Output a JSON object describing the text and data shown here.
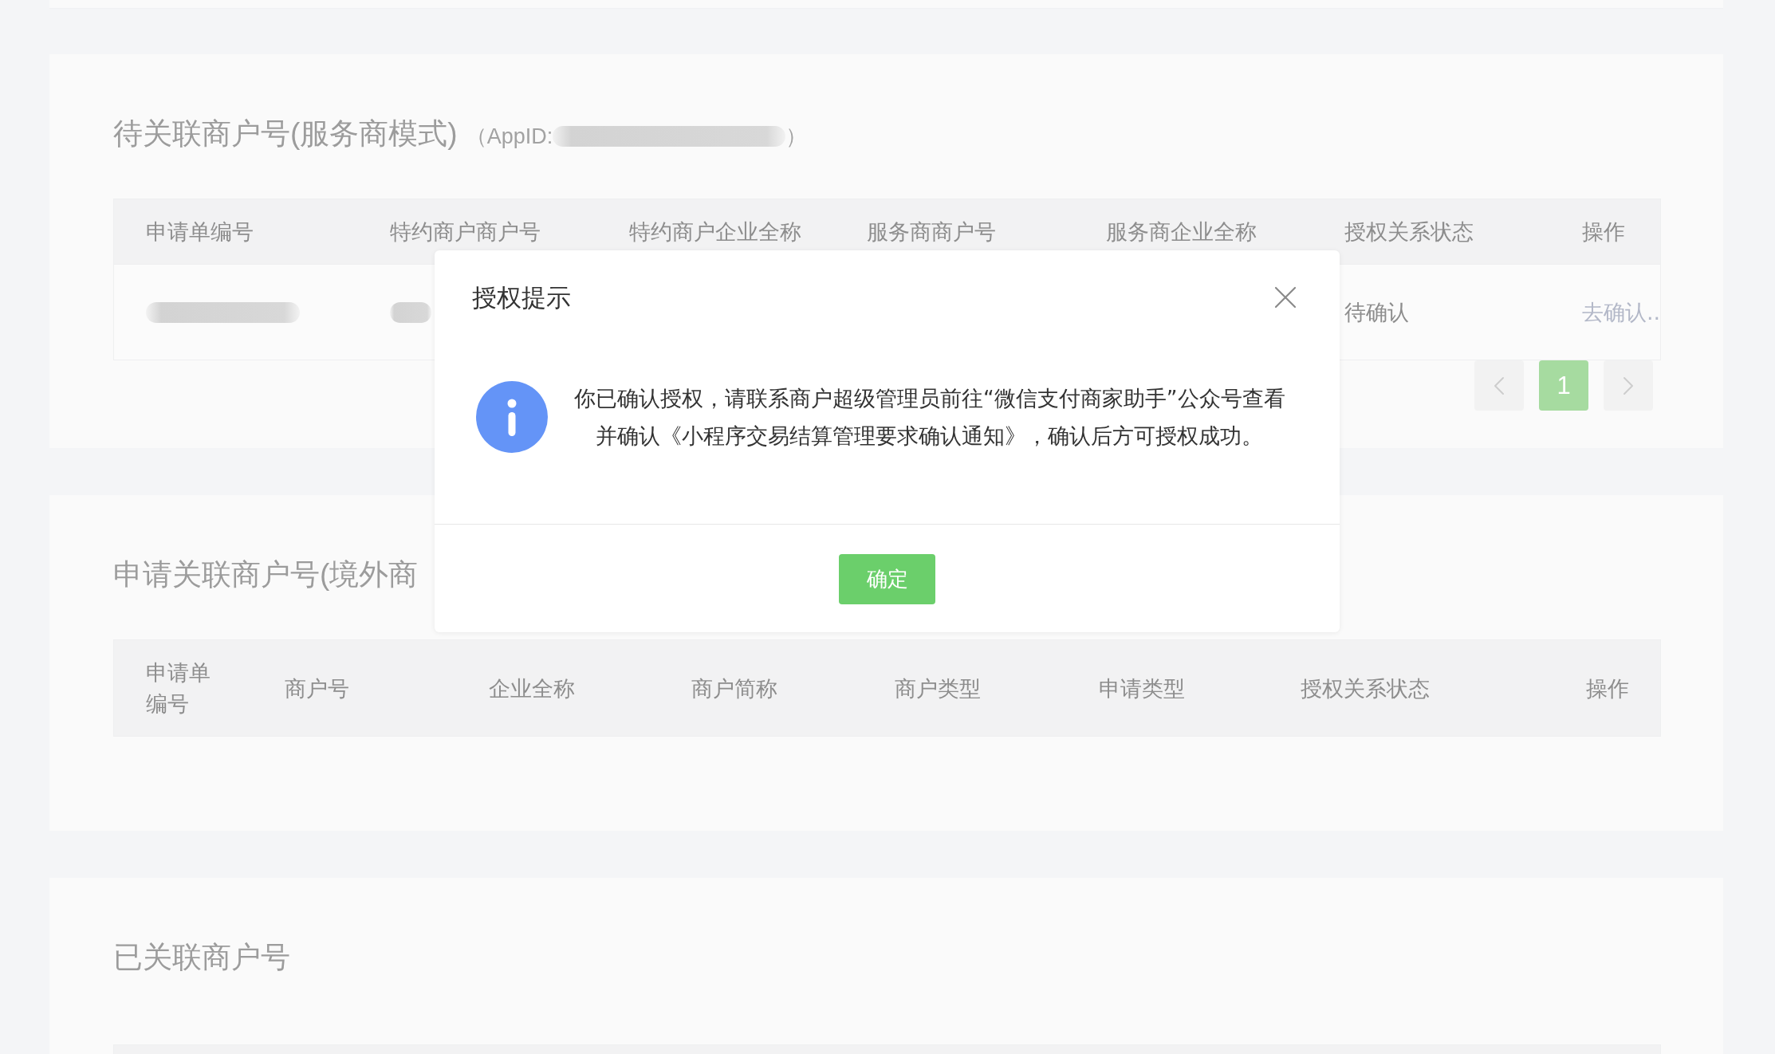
{
  "sections": [
    {
      "title": "待关联商户号(服务商模式)",
      "appid": {
        "prefix": "（AppID:",
        "redacted": true,
        "suffix": "）"
      },
      "table": {
        "columns": [
          "申请单编号",
          "特约商户商户号",
          "特约商户企业全称",
          "服务商商户号",
          "服务商企业全称",
          "授权关系状态",
          "操作"
        ],
        "rows": [
          {
            "cells": [
              {
                "kind": "redacted"
              },
              {
                "kind": "redacted"
              },
              {
                "kind": "covered"
              },
              {
                "kind": "covered"
              },
              {
                "kind": "covered"
              },
              {
                "kind": "text",
                "text": "待确认"
              },
              {
                "kind": "link",
                "text": "去确认.."
              }
            ]
          }
        ]
      },
      "pagination": {
        "prev_disabled": true,
        "pages": [
          {
            "label": "1",
            "selected": true
          }
        ],
        "next_disabled": true
      }
    },
    {
      "title": "申请关联商户号(境外商",
      "table": {
        "columns": [
          "申请单编号",
          "商户号",
          "企业全称",
          "商户简称",
          "商户类型",
          "申请类型",
          "授权关系状态",
          "操作"
        ]
      }
    },
    {
      "title": "已关联商户号"
    }
  ],
  "dialog": {
    "title": "授权提示",
    "message": "你已确认授权，请联系商户超级管理员前往“微信支付商家助手”公众号查看并确认《小程序交易结算管理要求确认通知》，确认后方可授权成功。",
    "confirm_label": "确定"
  }
}
